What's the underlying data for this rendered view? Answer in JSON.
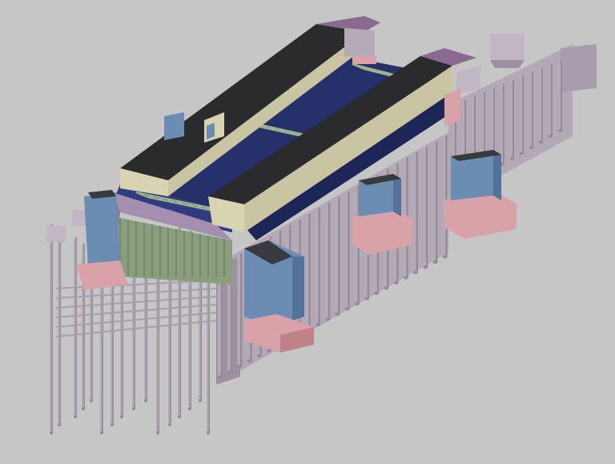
{
  "scene": {
    "type": "3d-structural-model",
    "view": "isometric",
    "background_color": "#c6c6c6",
    "colors": {
      "roof": "#2b2b2e",
      "roof_fascia": "#d8d3b0",
      "roof_fascia_shadow": "#b9b496",
      "deck": "#26306a",
      "deck_light": "#313c80",
      "truss": "#9fb48e",
      "pile": "#b5abb8",
      "pile_shade": "#958b98",
      "pile_cap": "#d9a2a8",
      "pile_cap_shade": "#bf8289",
      "tower": "#6b8cb3",
      "tower_shade": "#53719a",
      "tower_top": "#3a3a3e",
      "ramp": "#a58fb0",
      "diaphragm_wall": "#b3a8b6",
      "diaphragm_wall_shade": "#9c91a0"
    }
  }
}
